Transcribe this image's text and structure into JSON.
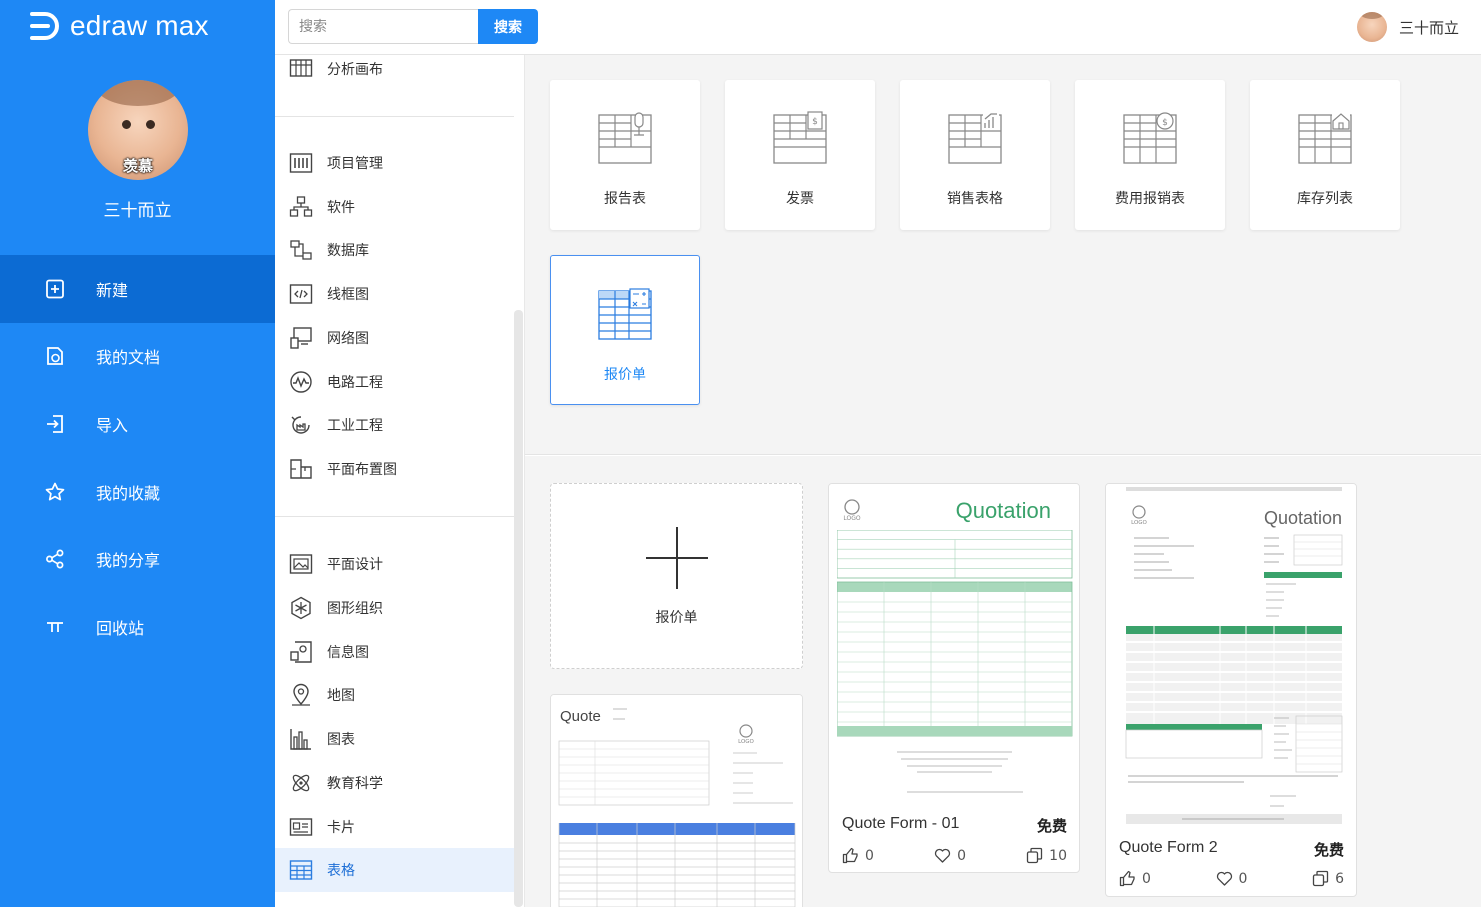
{
  "brand": {
    "name": "edraw max"
  },
  "user": {
    "name": "三十而立",
    "avatar_caption": "羡慕"
  },
  "nav": [
    {
      "label": "新建",
      "icon": "new-file-icon",
      "active": true
    },
    {
      "label": "我的文档",
      "icon": "documents-icon",
      "active": false
    },
    {
      "label": "导入",
      "icon": "import-icon",
      "active": false
    },
    {
      "label": "我的收藏",
      "icon": "star-icon",
      "active": false
    },
    {
      "label": "我的分享",
      "icon": "share-icon",
      "active": false
    },
    {
      "label": "回收站",
      "icon": "recycle-bin-icon",
      "active": false
    }
  ],
  "search": {
    "placeholder": "搜索",
    "button": "搜索"
  },
  "categories": [
    {
      "label": "分析画布",
      "icon": "canvas-icon"
    },
    {
      "label": "项目管理",
      "icon": "project-icon"
    },
    {
      "label": "软件",
      "icon": "software-icon"
    },
    {
      "label": "数据库",
      "icon": "database-icon"
    },
    {
      "label": "线框图",
      "icon": "wireframe-icon"
    },
    {
      "label": "网络图",
      "icon": "network-icon"
    },
    {
      "label": "电路工程",
      "icon": "circuit-icon"
    },
    {
      "label": "工业工程",
      "icon": "industrial-icon"
    },
    {
      "label": "平面布置图",
      "icon": "floorplan-icon"
    },
    {
      "label": "平面设计",
      "icon": "graphic-design-icon"
    },
    {
      "label": "图形组织",
      "icon": "graphic-organizer-icon"
    },
    {
      "label": "信息图",
      "icon": "infographic-icon"
    },
    {
      "label": "地图",
      "icon": "map-pin-icon"
    },
    {
      "label": "图表",
      "icon": "chart-icon"
    },
    {
      "label": "教育科学",
      "icon": "science-icon"
    },
    {
      "label": "卡片",
      "icon": "card-icon"
    },
    {
      "label": "表格",
      "icon": "table-icon",
      "active": true
    }
  ],
  "types": [
    {
      "label": "报告表",
      "icon": "report-table-icon"
    },
    {
      "label": "发票",
      "icon": "invoice-table-icon"
    },
    {
      "label": "销售表格",
      "icon": "sales-table-icon"
    },
    {
      "label": "费用报销表",
      "icon": "expense-table-icon"
    },
    {
      "label": "库存列表",
      "icon": "inventory-table-icon"
    },
    {
      "label": "报价单",
      "icon": "quotation-table-icon",
      "active": true
    }
  ],
  "new_card": {
    "label": "报价单"
  },
  "templates": [
    {
      "name": "Quote Form - 01",
      "price": "免费",
      "likes": "0",
      "favorites": "0",
      "copies": "10",
      "thumb_heading": "Quotation"
    },
    {
      "name": "Quote Form 2",
      "price": "免费",
      "likes": "0",
      "favorites": "0",
      "copies": "6",
      "thumb_heading": "Quotation"
    },
    {
      "name": "",
      "thumb_heading": "Quote"
    }
  ],
  "colors": {
    "sidebar": "#1e88f5",
    "sidebar_active": "#0c6bd3",
    "accent": "#1e88f5",
    "quote_green": "#3aa26b"
  }
}
